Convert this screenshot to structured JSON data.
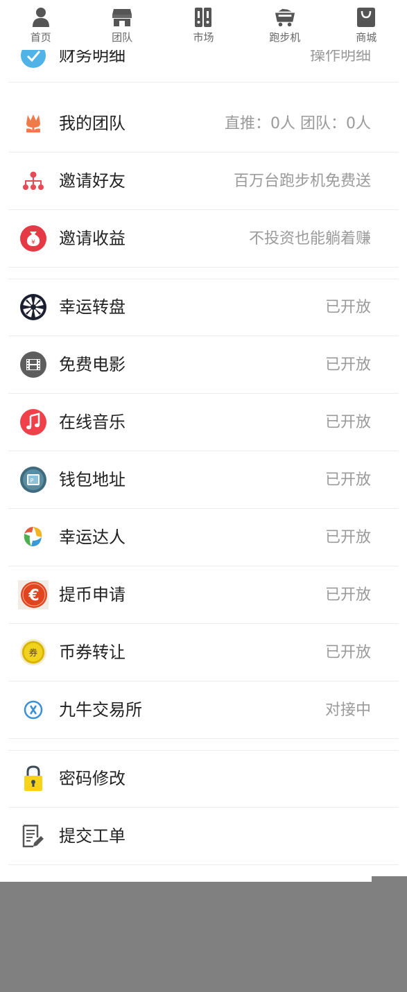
{
  "tabs": [
    {
      "label": "首页",
      "icon": "person-icon"
    },
    {
      "label": "团队",
      "icon": "store-icon"
    },
    {
      "label": "市场",
      "icon": "market-icon"
    },
    {
      "label": "跑步机",
      "icon": "mining-cart-icon"
    },
    {
      "label": "商城",
      "icon": "shopping-bag-icon"
    }
  ],
  "partial_row": {
    "label": "财务明细",
    "value": "操作明细"
  },
  "rows": [
    {
      "label": "我的团队",
      "value": "直推：0人 团队：0人",
      "icon": "tulip-icon"
    },
    {
      "label": "邀请好友",
      "value": "百万台跑步机免费送",
      "icon": "network-icon"
    },
    {
      "label": "邀请收益",
      "value": "不投资也能躺着赚",
      "icon": "money-bag-icon"
    },
    {
      "label": "幸运转盘",
      "value": "已开放",
      "icon": "wheel-icon"
    },
    {
      "label": "免费电影",
      "value": "已开放",
      "icon": "film-icon"
    },
    {
      "label": "在线音乐",
      "value": "已开放",
      "icon": "music-note-icon"
    },
    {
      "label": "钱包地址",
      "value": "已开放",
      "icon": "wallet-icon"
    },
    {
      "label": "幸运达人",
      "value": "已开放",
      "icon": "swirl-icon"
    },
    {
      "label": "提币申请",
      "value": "已开放",
      "icon": "euro-icon"
    },
    {
      "label": "币券转让",
      "value": "已开放",
      "icon": "coupon-icon"
    },
    {
      "label": "九牛交易所",
      "value": "对接中",
      "icon": "exchange-icon"
    },
    {
      "label": "密码修改",
      "value": "",
      "icon": "lock-icon"
    },
    {
      "label": "提交工单",
      "value": "",
      "icon": "document-edit-icon"
    }
  ],
  "coupon_char": "券",
  "colors": {
    "tab_text": "#666666",
    "label_text": "#222222",
    "value_text": "#9a9a9a",
    "divider": "#ececec",
    "overlay": "#808080"
  }
}
